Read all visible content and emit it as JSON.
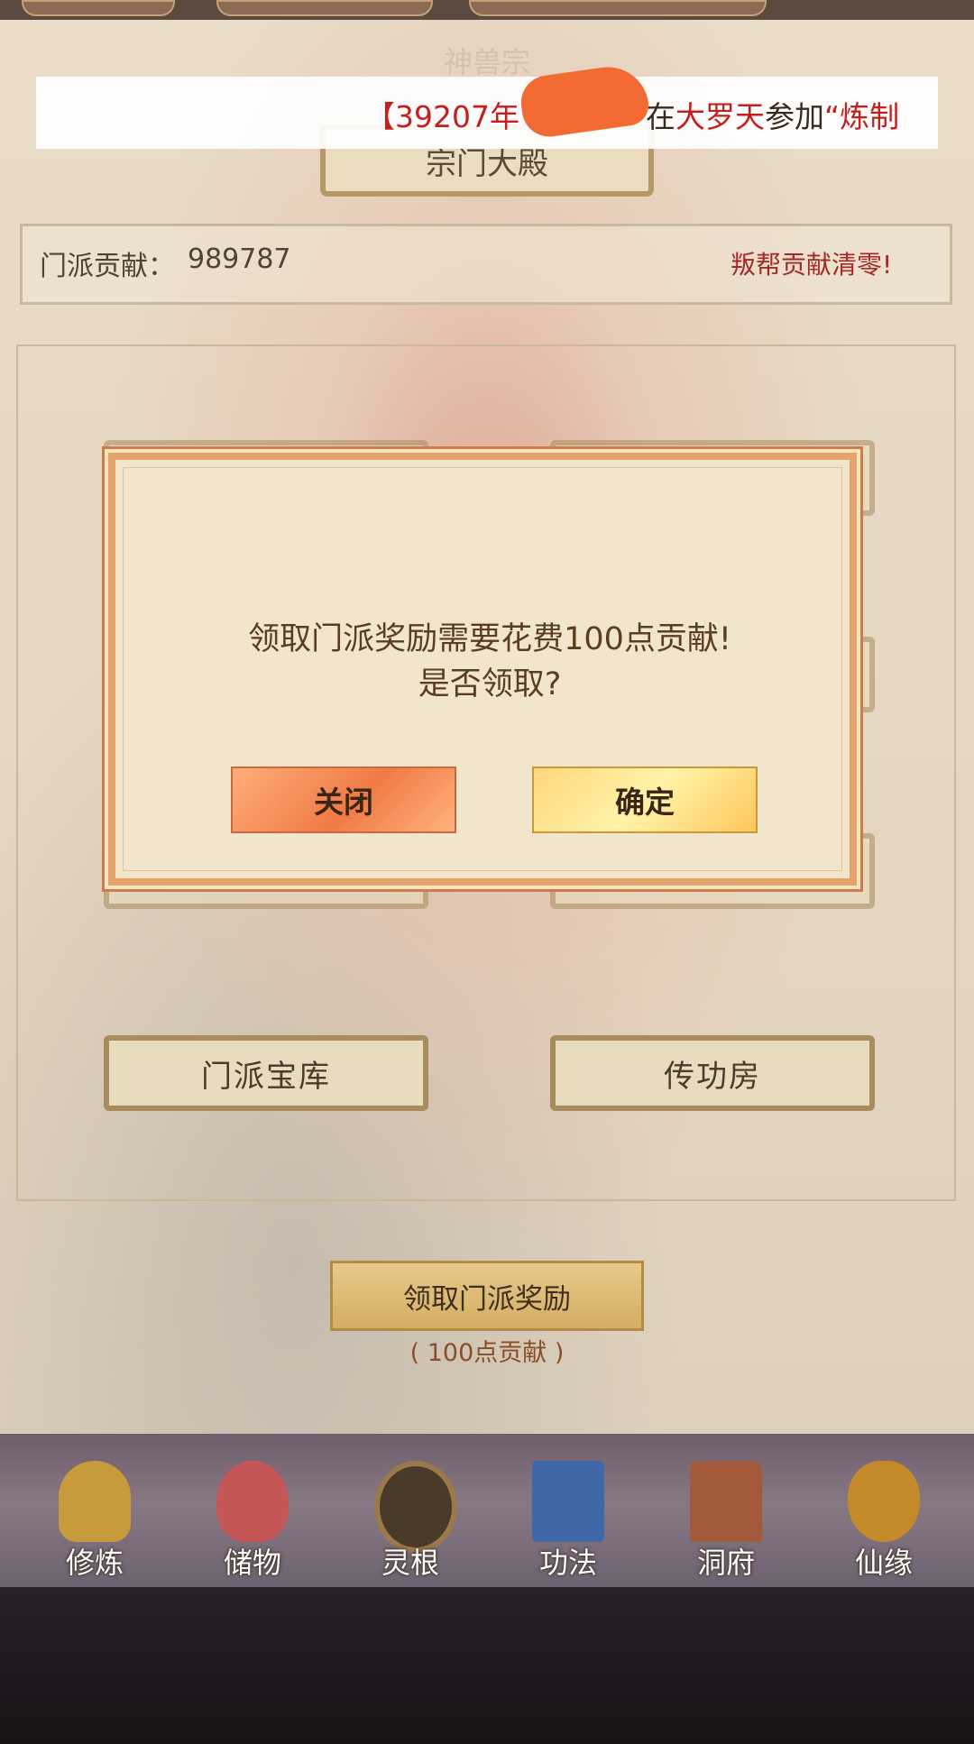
{
  "page": {
    "section_title": "神兽宗",
    "hall_button": "宗门大殿"
  },
  "contribution": {
    "label": "门派贡献：",
    "value": "989787",
    "warning": "叛帮贡献清零!"
  },
  "banner": {
    "bracket": "【",
    "year": "39207年",
    "in": "在",
    "place": "大罗天",
    "verb": "参加",
    "quote": "“炼制"
  },
  "buildings": [
    "门派宝库",
    "传功房"
  ],
  "reward": {
    "button": "领取门派奖励",
    "cost": "( 100点贡献 )"
  },
  "dialog": {
    "line1": "领取门派奖励需要花费100点贡献!",
    "line2": "是否领取?",
    "close": "关闭",
    "confirm": "确定"
  },
  "nav": [
    {
      "label": "修炼",
      "icon": "meditating-monk-icon",
      "color": "#c79a3c"
    },
    {
      "label": "储物",
      "icon": "pouch-icon",
      "color": "#c55656"
    },
    {
      "label": "灵根",
      "icon": "triskelion-medallion-icon",
      "color": "#4a3a2a"
    },
    {
      "label": "功法",
      "icon": "book-icon",
      "color": "#3f68a8"
    },
    {
      "label": "洞府",
      "icon": "pavilion-icon",
      "color": "#a35a3a"
    },
    {
      "label": "仙缘",
      "icon": "gourd-icon",
      "color": "#c48a2a"
    }
  ],
  "colors": {
    "accent_red": "#c41f1f",
    "dialog_border": "#e3a36d"
  }
}
